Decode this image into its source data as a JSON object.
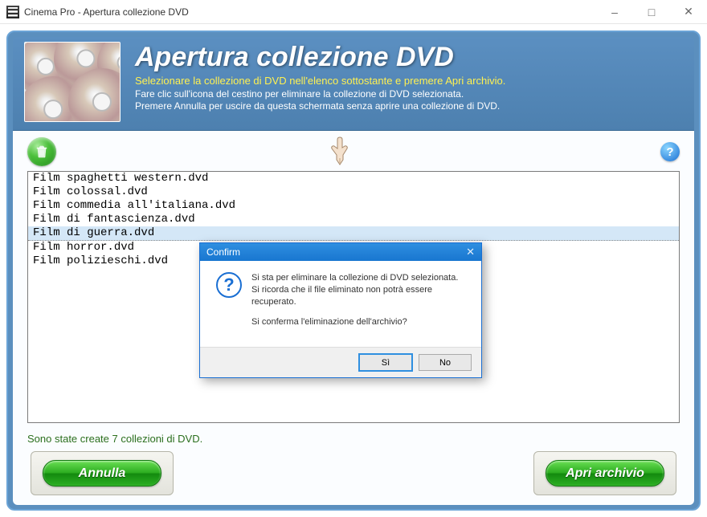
{
  "window": {
    "title": "Cinema Pro - Apertura collezione DVD"
  },
  "header": {
    "title": "Apertura collezione DVD",
    "line1": "Selezionare la collezione di DVD nell'elenco sottostante e premere Apri archivio.",
    "line2": "Fare clic sull'icona del cestino per eliminare la collezione di DVD selezionata.",
    "line3": "Premere Annulla per uscire da questa schermata senza aprire una collezione di DVD."
  },
  "list": {
    "items": [
      "Film spaghetti western.dvd",
      "Film colossal.dvd",
      "Film commedia all'italiana.dvd",
      "Film di fantascienza.dvd",
      "Film di guerra.dvd",
      "Film horror.dvd",
      "Film polizieschi.dvd"
    ],
    "selected_index": 4
  },
  "status": "Sono state create 7 collezioni di DVD.",
  "buttons": {
    "cancel": "Annulla",
    "open": "Apri archivio"
  },
  "dialog": {
    "title": "Confirm",
    "message1": "Si sta per eliminare la collezione di DVD selezionata. Si ricorda che il file eliminato non potrà essere recuperato.",
    "message2": "Si conferma l'eliminazione dell'archivio?",
    "yes": "Sì",
    "no": "No"
  },
  "icons": {
    "trash": "trash-icon",
    "help": "help-icon",
    "hand": "hand-pointing-icon",
    "question": "question-icon"
  }
}
